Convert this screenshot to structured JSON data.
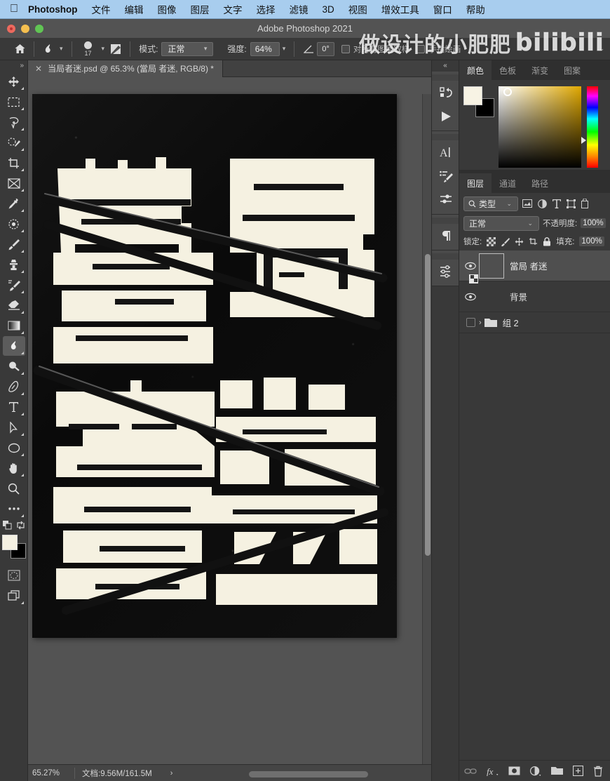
{
  "macbar": {
    "apple_icon": "apple-logo",
    "app_name": "Photoshop",
    "menus": [
      "文件",
      "编辑",
      "图像",
      "图层",
      "文字",
      "选择",
      "滤镜",
      "3D",
      "视图",
      "增效工具",
      "窗口",
      "帮助"
    ]
  },
  "titlebar": {
    "title": "Adobe Photoshop 2021",
    "close": "",
    "minimize": "",
    "zoom": ""
  },
  "options_bar": {
    "home_icon": "home-icon",
    "tool_icon": "smudge-tool-icon",
    "brush_size": "17",
    "brush_panel_icon": "brush-settings-icon",
    "mode_label": "模式:",
    "mode_value": "正常",
    "strength_label": "强度:",
    "strength_value": "64%",
    "angle_icon": "angle-icon",
    "angle_value": "0°",
    "sample_all_layers": "对所有图层取样",
    "finger_painting": "手指绘画",
    "overflow_caret": "⌄"
  },
  "watermark": {
    "text": "做设计的小肥肥",
    "logo": "bilibili"
  },
  "toolbar": {
    "collapse_icon": "chevron-double-right-icon",
    "tools": [
      {
        "name": "move-tool",
        "icon": "move-icon"
      },
      {
        "name": "marquee-tool",
        "icon": "rectangular-marquee-icon"
      },
      {
        "name": "lasso-tool",
        "icon": "lasso-icon"
      },
      {
        "name": "quick-selection-tool",
        "icon": "quick-selection-icon"
      },
      {
        "name": "crop-tool",
        "icon": "crop-icon"
      },
      {
        "name": "frame-tool",
        "icon": "frame-icon"
      },
      {
        "name": "eyedropper-tool",
        "icon": "eyedropper-icon"
      },
      {
        "name": "spot-healing-tool",
        "icon": "healing-brush-icon"
      },
      {
        "name": "brush-tool",
        "icon": "brush-icon"
      },
      {
        "name": "clone-stamp-tool",
        "icon": "clone-stamp-icon"
      },
      {
        "name": "history-brush-tool",
        "icon": "history-brush-icon"
      },
      {
        "name": "eraser-tool",
        "icon": "eraser-icon"
      },
      {
        "name": "gradient-tool",
        "icon": "gradient-icon"
      },
      {
        "name": "smudge-tool",
        "icon": "smudge-icon"
      },
      {
        "name": "dodge-tool",
        "icon": "dodge-icon"
      },
      {
        "name": "pen-tool",
        "icon": "pen-icon"
      },
      {
        "name": "type-tool",
        "icon": "type-icon"
      },
      {
        "name": "path-selection-tool",
        "icon": "path-arrow-icon"
      },
      {
        "name": "ellipse-tool",
        "icon": "ellipse-icon"
      },
      {
        "name": "hand-tool",
        "icon": "hand-icon"
      },
      {
        "name": "zoom-tool",
        "icon": "magnifier-icon"
      },
      {
        "name": "edit-toolbar",
        "icon": "ellipsis-icon"
      }
    ],
    "active_tool": "smudge-tool",
    "foreground_color": "#f5f1e3",
    "background_color": "#000000",
    "quick_mask_icon": "quick-mask-icon",
    "screen_mode_icon": "screen-mode-icon",
    "default_colors_icon": "default-colors-icon",
    "swap_colors_icon": "swap-colors-icon"
  },
  "document": {
    "tab_title": "当局者迷.psd @ 65.3% (當局 者迷, RGB/8) *",
    "tab_close_icon": "close-icon",
    "artwork_text": "當局者迷",
    "artwork_bg_color": "#0d0d0d",
    "artwork_fg_color": "#f5f1e1"
  },
  "status_bar": {
    "zoom": "65.27%",
    "doc_info": "文档:9.56M/161.5M",
    "expand_icon": "chevron-right-icon"
  },
  "icon_dock": {
    "collapse_icon": "chevron-double-left-icon",
    "buttons": [
      {
        "name": "history-panel-icon",
        "icon": "history-icon"
      },
      {
        "name": "actions-panel-icon",
        "icon": "play-icon"
      },
      {
        "name": "character-panel-icon",
        "icon": "character-A-icon"
      },
      {
        "name": "brush-settings-panel-icon",
        "icon": "brush-settings-icon"
      },
      {
        "name": "adjustments-panel-icon",
        "icon": "sliders-icon"
      },
      {
        "name": "paragraph-panel-icon",
        "icon": "pilcrow-icon"
      },
      {
        "name": "properties-panel-icon",
        "icon": "properties-sliders-icon"
      }
    ]
  },
  "color_panel": {
    "tabs": [
      {
        "label": "颜色",
        "active": true
      },
      {
        "label": "色板",
        "active": false
      },
      {
        "label": "渐变",
        "active": false
      },
      {
        "label": "图案",
        "active": false
      }
    ],
    "foreground": "#f7f3e4",
    "background": "#000000",
    "field_hue": "#e0a800"
  },
  "layers_panel": {
    "tabs": [
      {
        "label": "图层",
        "active": true
      },
      {
        "label": "通道",
        "active": false
      },
      {
        "label": "路径",
        "active": false
      }
    ],
    "filter": {
      "search_icon": "search-icon",
      "value": "类型",
      "caret": "⌄",
      "icons": [
        {
          "name": "filter-pixel-icon"
        },
        {
          "name": "filter-adjustment-icon"
        },
        {
          "name": "filter-type-icon"
        },
        {
          "name": "filter-shape-icon"
        },
        {
          "name": "filter-smart-object-icon"
        }
      ]
    },
    "blend_mode": "正常",
    "blend_caret": "⌄",
    "opacity_label": "不透明度:",
    "opacity_value": "100%",
    "lock_label": "锁定:",
    "lock_icons": [
      {
        "name": "lock-transparent-pixels-icon"
      },
      {
        "name": "lock-image-pixels-icon"
      },
      {
        "name": "lock-position-icon"
      },
      {
        "name": "lock-artboard-icon"
      },
      {
        "name": "lock-all-icon"
      }
    ],
    "fill_label": "填充:",
    "fill_value": "100%",
    "layers": [
      {
        "name": "當局 者迷",
        "visible": true,
        "selected": true,
        "type": "pixel"
      },
      {
        "name": "背景",
        "visible": true,
        "selected": false,
        "type": "background"
      },
      {
        "name": "组 2",
        "visible": false,
        "selected": false,
        "type": "group"
      }
    ],
    "footer_icons": [
      {
        "name": "link-layers-icon"
      },
      {
        "name": "layer-style-fx-icon"
      },
      {
        "name": "add-layer-mask-icon"
      },
      {
        "name": "new-adjustment-layer-icon"
      },
      {
        "name": "new-group-icon"
      },
      {
        "name": "new-layer-icon"
      },
      {
        "name": "delete-layer-icon"
      }
    ]
  }
}
